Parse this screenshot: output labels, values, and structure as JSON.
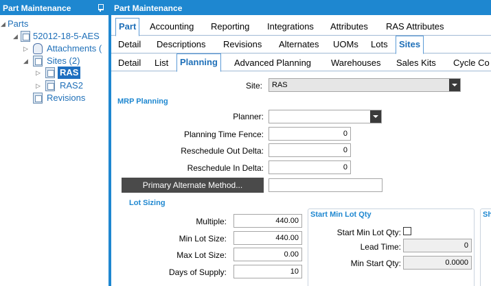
{
  "left_panel": {
    "title": "Part Maintenance",
    "tree": {
      "root": "Parts",
      "part": "52012-18-5-AES",
      "attachments": "Attachments (",
      "sites": "Sites (2)",
      "site1": "RAS",
      "site2": "RAS2",
      "revisions": "Revisions"
    }
  },
  "right_panel": {
    "title": "Part Maintenance",
    "tabs_l1": [
      "Part",
      "Accounting",
      "Reporting",
      "Integrations",
      "Attributes",
      "RAS Attributes"
    ],
    "tabs_l2": [
      "Detail",
      "Descriptions",
      "Revisions",
      "Alternates",
      "UOMs",
      "Lots",
      "Sites"
    ],
    "tabs_l3": [
      "Detail",
      "List",
      "Planning",
      "Advanced Planning",
      "Warehouses",
      "Sales Kits",
      "Cycle Co"
    ],
    "site": {
      "label": "Site:",
      "value": "RAS"
    },
    "mrp": {
      "section": "MRP Planning",
      "planner_label": "Planner:",
      "planner_value": "",
      "ptf_label": "Planning Time Fence:",
      "ptf_value": "0",
      "rod_label": "Reschedule Out Delta:",
      "rod_value": "0",
      "rid_label": "Reschedule In Delta:",
      "rid_value": "0",
      "pam_button": "Primary Alternate Method...",
      "pam_value": ""
    },
    "lot_sizing": {
      "section": "Lot Sizing",
      "multiple_label": "Multiple:",
      "multiple_value": "440.00",
      "min_label": "Min Lot Size:",
      "min_value": "440.00",
      "max_label": "Max Lot Size:",
      "max_value": "0.00",
      "days_label": "Days of Supply:",
      "days_value": "10"
    },
    "start_min": {
      "section": "Start Min Lot Qty",
      "qty_label": "Start Min Lot Qty:",
      "lead_label": "Lead Time:",
      "lead_value": "0",
      "minstart_label": "Min Start Qty:",
      "minstart_value": "0.0000"
    },
    "third_section": "Sh"
  }
}
